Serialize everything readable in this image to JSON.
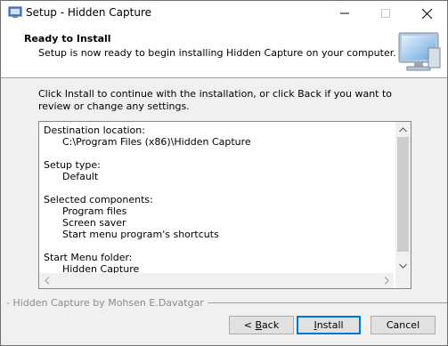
{
  "window": {
    "title": "Setup - Hidden Capture"
  },
  "header": {
    "title": "Ready to Install",
    "subtitle": "Setup is now ready to begin installing Hidden Capture on your computer."
  },
  "intro_text": "Click Install to continue with the installation, or click Back if you want to review or change any settings.",
  "summary": {
    "lines": [
      "Destination location:",
      "      C:\\Program Files (x86)\\Hidden Capture",
      "",
      "Setup type:",
      "      Default",
      "",
      "Selected components:",
      "      Program files",
      "      Screen saver",
      "      Start menu program's shortcuts",
      "",
      "Start Menu folder:",
      "      Hidden Capture"
    ],
    "scroll_position": 0.0
  },
  "footer": {
    "branding": "- Hidden Capture by Mohsen E.Davatgar"
  },
  "buttons": {
    "back_prefix": "< ",
    "back_accel": "B",
    "back_rest": "ack",
    "install_accel": "I",
    "install_rest": "nstall",
    "cancel": "Cancel"
  },
  "colors": {
    "accent": "#0078d7",
    "separator": "#a0a0a0",
    "disabled_text": "#8c8c8c"
  }
}
